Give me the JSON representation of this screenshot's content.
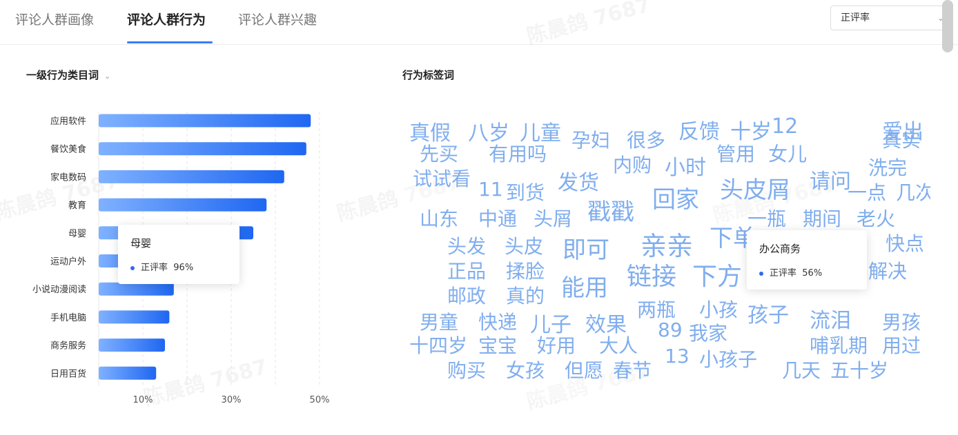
{
  "tabs": [
    {
      "label": "评论人群画像"
    },
    {
      "label": "评论人群行为"
    },
    {
      "label": "评论人群兴趣"
    }
  ],
  "select": {
    "value": "正评率"
  },
  "left": {
    "title": "一级行为类目词"
  },
  "right": {
    "title": "行为标签词"
  },
  "colors": {
    "accent": "#3a7bf5",
    "bar_start": "#7fb1ff",
    "bar_end": "#1f67f2",
    "word": "#4f8fe8"
  },
  "chart_data": {
    "type": "bar",
    "orientation": "horizontal",
    "categories": [
      "应用软件",
      "餐饮美食",
      "家电数码",
      "教育",
      "母婴",
      "运动户外",
      "小说动漫阅读",
      "手机电脑",
      "商务服务",
      "日用百货"
    ],
    "values": [
      48,
      47,
      42,
      38,
      35,
      16,
      17,
      16,
      15,
      13
    ],
    "x_ticks": [
      "10%",
      "30%",
      "50%"
    ],
    "x_tick_values": [
      10,
      30,
      50
    ],
    "xlim": [
      0,
      50
    ],
    "grid": "vertical dashed"
  },
  "tooltip_left": {
    "title": "母婴",
    "series": "正评率",
    "value": "96%"
  },
  "tooltip_right": {
    "title": "办公商务",
    "series": "正评率",
    "value": "56%"
  },
  "word_cloud": [
    "真假",
    "八岁",
    "儿童",
    "孕妇",
    "很多",
    "反馈",
    "十岁",
    "12",
    "真实",
    "爱出",
    "先买",
    "有用吗",
    "管用",
    "女儿",
    "内购",
    "小时",
    "试试看",
    "发货",
    "请问",
    "洗完",
    "11",
    "到货",
    "头皮屑",
    "回家",
    "一点",
    "几次",
    "山东",
    "中通",
    "头屑",
    "戳戳",
    "一瓶",
    "期间",
    "老火",
    "头发",
    "头皮",
    "即可",
    "亲亲",
    "下单",
    "快点",
    "正品",
    "揉脸",
    "真的",
    "能用",
    "链接",
    "下方",
    "邮政",
    "孩子",
    "流泪",
    "解决",
    "男童",
    "快递",
    "儿子",
    "效果",
    "两瓶",
    "小孩",
    "男孩",
    "89",
    "我家",
    "十四岁",
    "宝宝",
    "好用",
    "大人",
    "哺乳期",
    "用过",
    "购买",
    "女孩",
    "但愿",
    "春节",
    "13",
    "小孩子",
    "几天",
    "五十岁"
  ],
  "watermark": "陈晨鸽 7687"
}
